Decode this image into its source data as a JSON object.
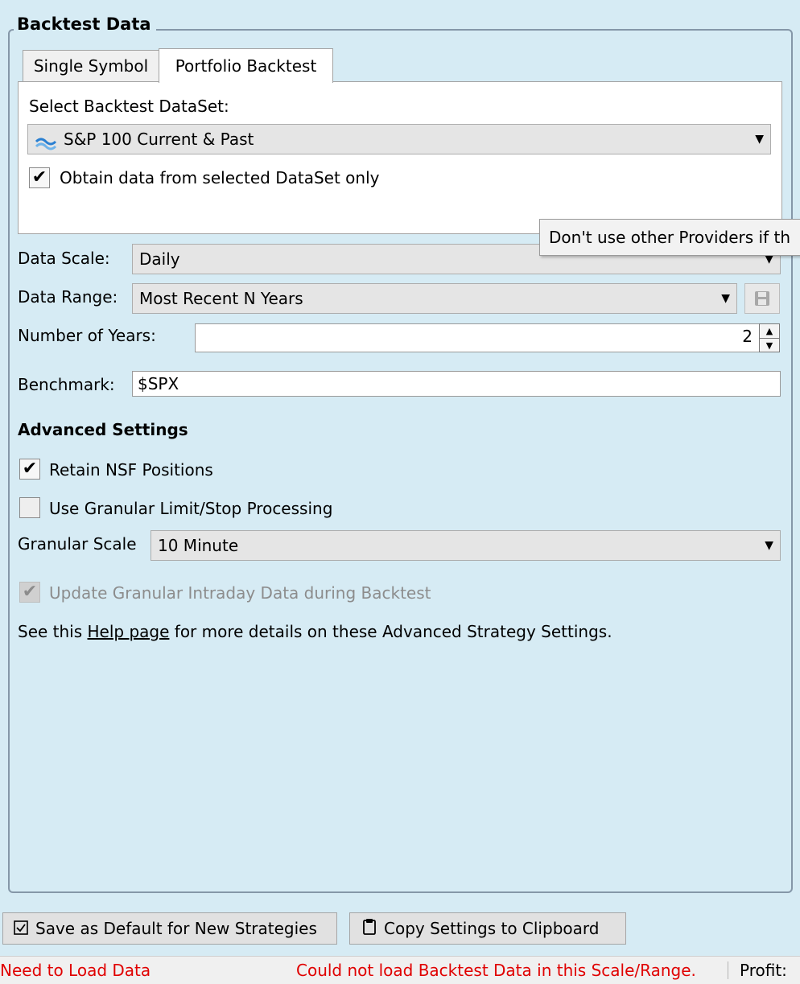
{
  "group": {
    "title": "Backtest Data"
  },
  "tabs": [
    {
      "label": "Single Symbol",
      "active": false
    },
    {
      "label": "Portfolio Backtest",
      "active": true
    }
  ],
  "dataset": {
    "label": "Select Backtest DataSet:",
    "selected": "S&P 100 Current & Past",
    "icon": "dataset-icon",
    "only_selected_label": "Obtain data from selected DataSet only",
    "only_selected_checked": true
  },
  "tooltip": {
    "text": "Don't use other Providers if th"
  },
  "data_scale": {
    "label": "Data Scale:",
    "value": "Daily"
  },
  "data_range": {
    "label": "Data Range:",
    "value": "Most Recent N Years"
  },
  "years": {
    "label": "Number of Years:",
    "value": "2"
  },
  "benchmark": {
    "label": "Benchmark:",
    "value": "$SPX"
  },
  "advanced": {
    "title": "Advanced Settings",
    "retain_nsf_label": "Retain NSF Positions",
    "retain_nsf_checked": true,
    "granular_limit_label": "Use Granular Limit/Stop Processing",
    "granular_limit_checked": false,
    "granular_scale_label": "Granular Scale",
    "granular_scale_value": "10 Minute",
    "update_granular_label": "Update Granular Intraday Data during Backtest",
    "update_granular_checked": true,
    "help_prefix": "See this ",
    "help_link": "Help page",
    "help_suffix": " for more details on these Advanced Strategy Settings."
  },
  "buttons": {
    "save_default": "Save as Default for New Strategies",
    "copy_settings": "Copy Settings to Clipboard"
  },
  "status": {
    "left": "Need to Load Data",
    "center": "Could not load Backtest Data in this Scale/Range.",
    "right": "Profit:"
  },
  "colors": {
    "background": "#d6ebf4",
    "error": "#e00000",
    "icon_blue": "#2a7fd1"
  }
}
